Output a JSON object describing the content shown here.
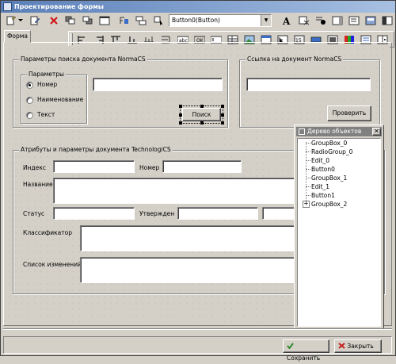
{
  "window": {
    "title": "Проектирование формы"
  },
  "toolbar": {
    "component_combo": "Button0(Button)",
    "row1_icons": [
      "new-form-icon",
      "dropdown-arrow-icon",
      "edit-form-icon",
      "delete-icon",
      "bring-front-icon",
      "send-back-icon",
      "window-icon",
      "align-icon",
      "tab-order-icon",
      "select-icon"
    ],
    "row1_right_icons": [
      "font-icon",
      "clear-format-icon",
      "radio-tool-icon",
      "listbox-tool-icon",
      "memo-tool-icon",
      "panel-tool-icon",
      "layout-tool-icon"
    ],
    "row2_icons": [
      "align-left-icon",
      "align-right-icon",
      "align-top-icon",
      "align-bottom-icon",
      "space-horz-icon",
      "space-vert-icon",
      "abc-label-icon",
      "ok-button-icon",
      "edit-field-icon",
      "grid-tool-icon",
      "image-tool-icon",
      "table-tool-icon",
      "tree-tool-icon",
      "size-tool-icon",
      "toggle-tool-icon",
      "number-tool-icon",
      "color-tool-icon",
      "property-tool-icon",
      "scroll-tool-icon",
      "split-tool-icon"
    ]
  },
  "tabs": {
    "form": "Форма"
  },
  "search_group": {
    "title": "Параметры поиска документа NormaCS",
    "params_title": "Параметры",
    "options": [
      "Номер",
      "Наименование",
      "Текст"
    ],
    "selected": "Номер",
    "input_value": "",
    "search_button": "Поиск"
  },
  "link_group": {
    "title": "Ссылка на документ NormaCS",
    "input_value": "",
    "check_button": "Проверить"
  },
  "attrs_group": {
    "title": "Атрибуты и параметры документа TechnologiCS",
    "index_label": "Индекс",
    "number_label": "Номер",
    "name_label": "Название",
    "status_label": "Статус",
    "approved_label": "Утвержден",
    "classifier_label": "Классификатор",
    "changes_label": "Список изменений"
  },
  "object_tree": {
    "title": "Дерево объектов",
    "nodes": [
      "GroupBox_0",
      "RadioGroup_0",
      "Edit_0",
      "Button0",
      "GroupBox_1",
      "Edit_1",
      "Button1",
      "GroupBox_2"
    ]
  },
  "footer": {
    "save": "Сохранить",
    "close": "Закрыть"
  },
  "colors": {
    "titlebar": "#5a7fb8",
    "face": "#d4d0c8",
    "save_icon": "#2e8b2e",
    "close_icon": "#c62020"
  }
}
